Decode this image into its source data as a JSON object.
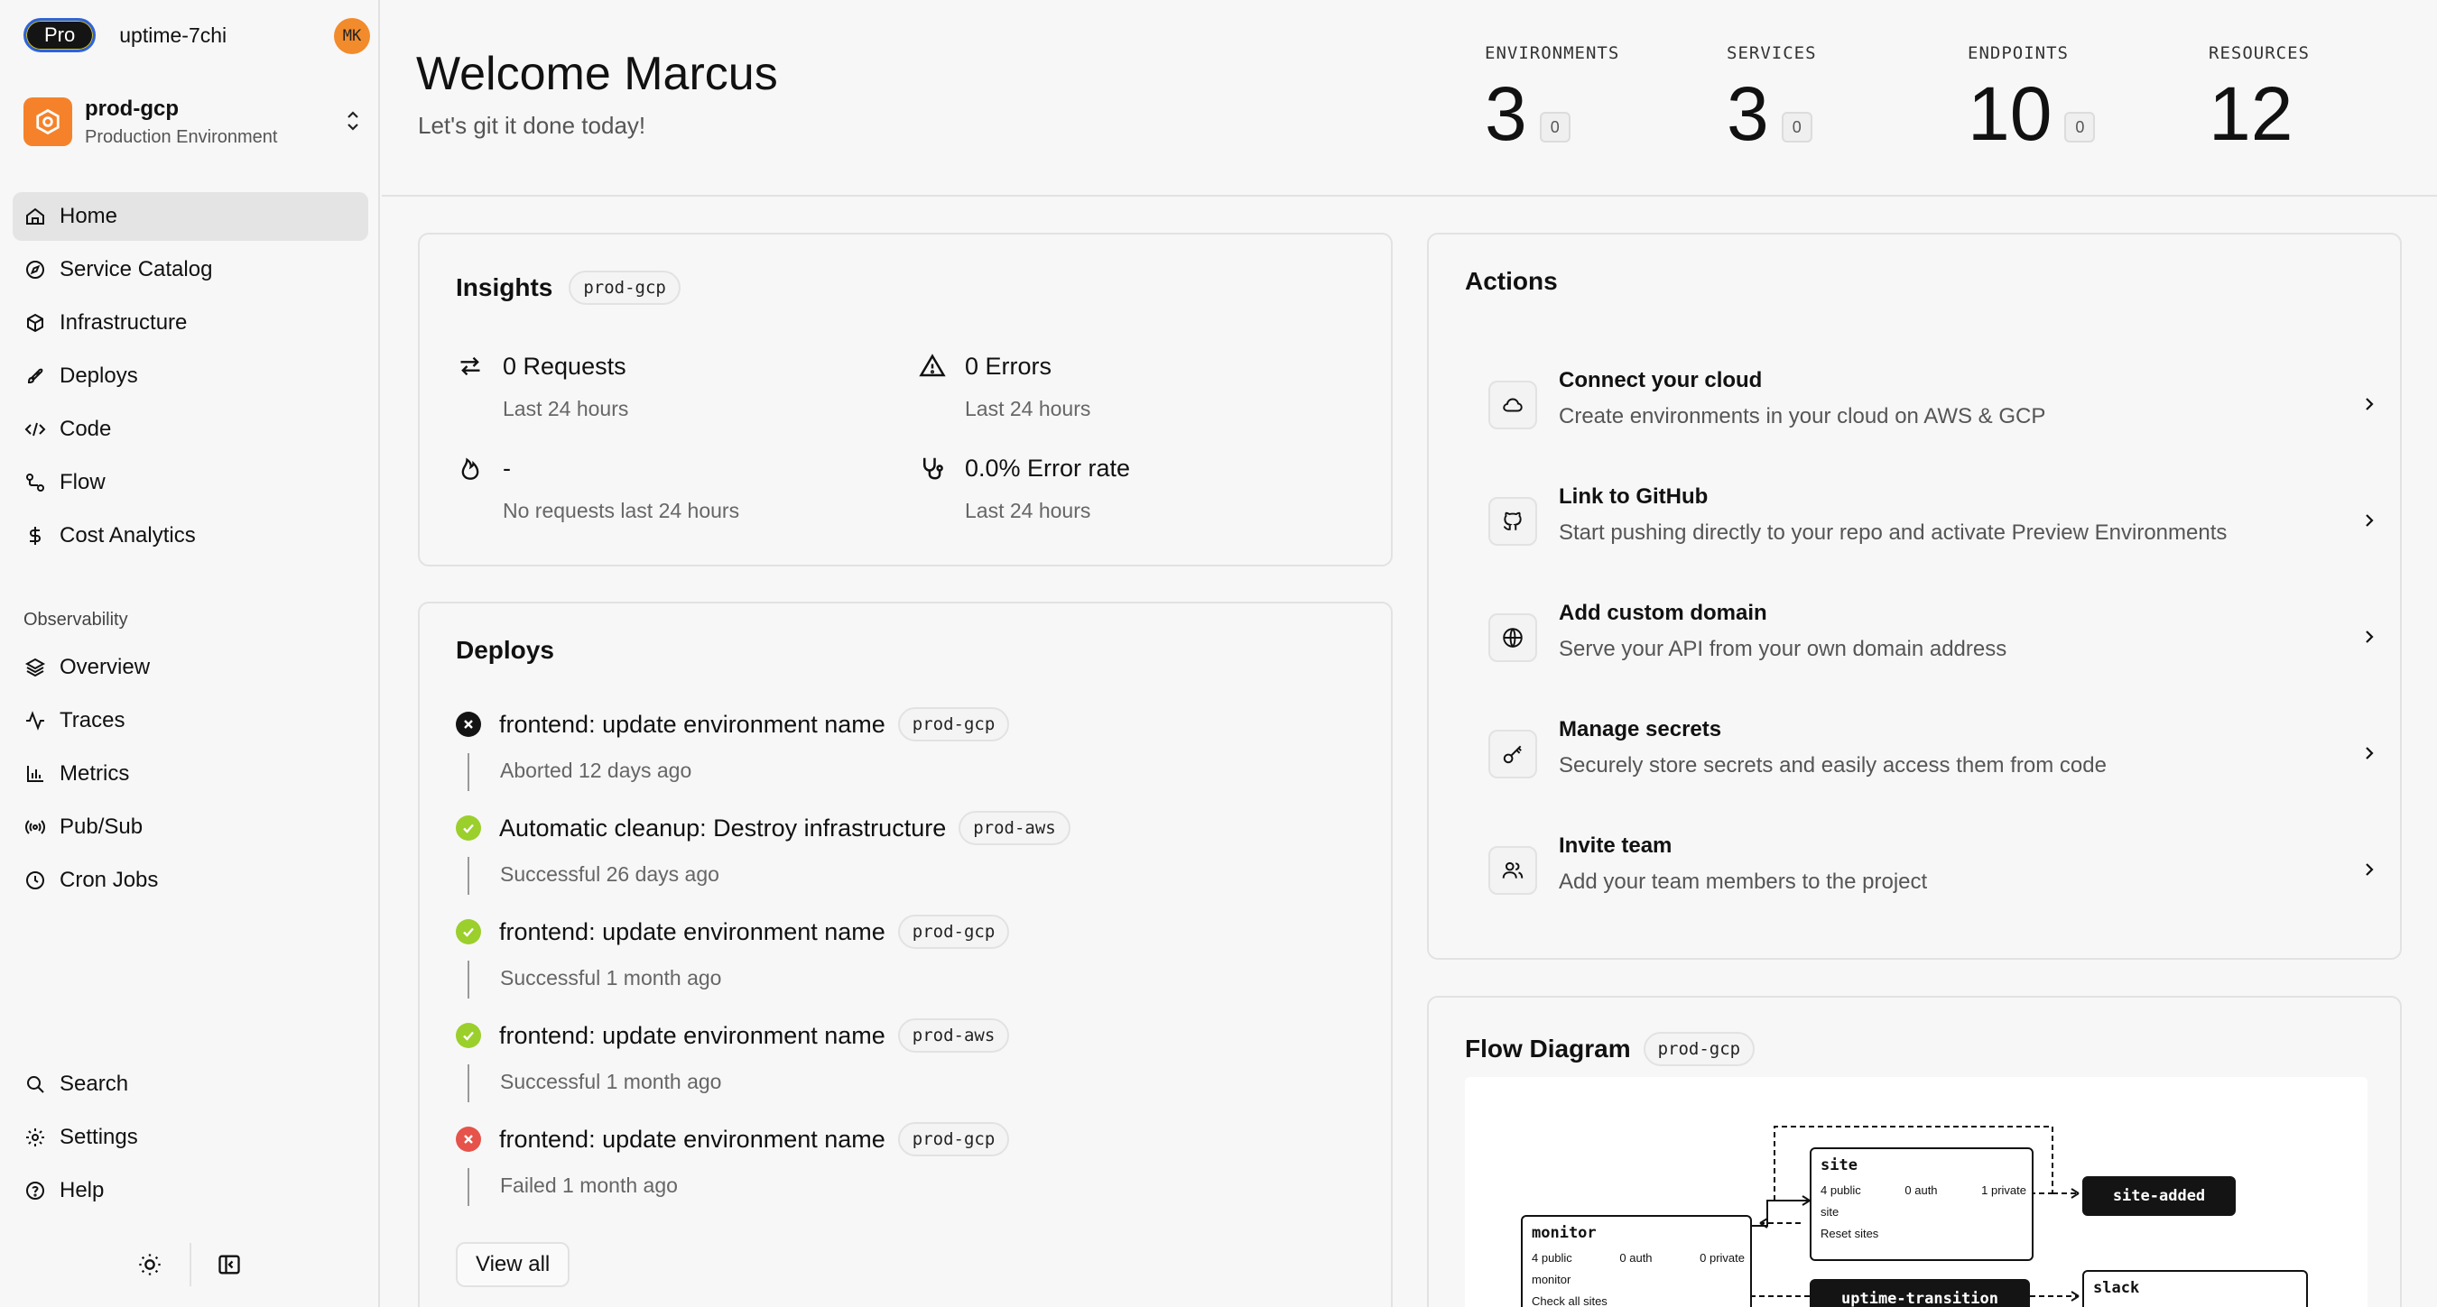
{
  "org": {
    "plan": "Pro",
    "name": "uptime-7chi",
    "avatar_initials": "MK"
  },
  "env": {
    "name": "prod-gcp",
    "description": "Production Environment"
  },
  "nav": {
    "main": [
      {
        "label": "Home",
        "icon": "home-icon"
      },
      {
        "label": "Service Catalog",
        "icon": "compass-icon"
      },
      {
        "label": "Infrastructure",
        "icon": "box-icon"
      },
      {
        "label": "Deploys",
        "icon": "rocket-icon"
      },
      {
        "label": "Code",
        "icon": "code-icon"
      },
      {
        "label": "Flow",
        "icon": "flow-icon"
      },
      {
        "label": "Cost Analytics",
        "icon": "dollar-icon"
      }
    ],
    "observability_label": "Observability",
    "observability": [
      {
        "label": "Overview",
        "icon": "layers-icon"
      },
      {
        "label": "Traces",
        "icon": "activity-icon"
      },
      {
        "label": "Metrics",
        "icon": "bar-chart-icon"
      },
      {
        "label": "Pub/Sub",
        "icon": "broadcast-icon"
      },
      {
        "label": "Cron Jobs",
        "icon": "clock-icon"
      }
    ],
    "bottom": [
      {
        "label": "Search",
        "icon": "search-icon"
      },
      {
        "label": "Settings",
        "icon": "gear-icon"
      },
      {
        "label": "Help",
        "icon": "help-icon"
      }
    ]
  },
  "header": {
    "welcome": "Welcome Marcus",
    "subtitle": "Let's git it done today!",
    "stats": [
      {
        "label": "ENVIRONMENTS",
        "value": "3",
        "delta": "0"
      },
      {
        "label": "SERVICES",
        "value": "3",
        "delta": "0"
      },
      {
        "label": "ENDPOINTS",
        "value": "10",
        "delta": "0"
      },
      {
        "label": "RESOURCES",
        "value": "12"
      }
    ]
  },
  "insights": {
    "title": "Insights",
    "env_tag": "prod-gcp",
    "items": [
      {
        "value": "0 Requests",
        "caption": "Last 24 hours"
      },
      {
        "value": "0 Errors",
        "caption": "Last 24 hours"
      },
      {
        "value": "-",
        "caption": "No requests last 24 hours"
      },
      {
        "value": "0.0% Error rate",
        "caption": "Last 24 hours"
      }
    ]
  },
  "deploys": {
    "title": "Deploys",
    "items": [
      {
        "message": "frontend: update environment name",
        "env": "prod-gcp",
        "status": "Aborted 12 days ago",
        "state": "aborted"
      },
      {
        "message": "Automatic cleanup: Destroy infrastructure",
        "env": "prod-aws",
        "status": "Successful 26 days ago",
        "state": "success"
      },
      {
        "message": "frontend: update environment name",
        "env": "prod-gcp",
        "status": "Successful 1 month ago",
        "state": "success"
      },
      {
        "message": "frontend: update environment name",
        "env": "prod-aws",
        "status": "Successful 1 month ago",
        "state": "success"
      },
      {
        "message": "frontend: update environment name",
        "env": "prod-gcp",
        "status": "Failed 1 month ago",
        "state": "failed"
      }
    ],
    "view_all": "View all"
  },
  "actions": {
    "title": "Actions",
    "items": [
      {
        "title": "Connect your cloud",
        "description": "Create environments in your cloud on AWS & GCP",
        "icon": "cloud-icon"
      },
      {
        "title": "Link to GitHub",
        "description": "Start pushing directly to your repo and activate Preview Environments",
        "icon": "github-icon"
      },
      {
        "title": "Add custom domain",
        "description": "Serve your API from your own domain address",
        "icon": "globe-icon"
      },
      {
        "title": "Manage secrets",
        "description": "Securely store secrets and easily access them from code",
        "icon": "key-icon"
      },
      {
        "title": "Invite team",
        "description": "Add your team members to the project",
        "icon": "users-icon"
      }
    ]
  },
  "flow": {
    "title": "Flow Diagram",
    "env_tag": "prod-gcp",
    "nodes": {
      "site": {
        "name": "site",
        "public": "4 public",
        "auth": "0 auth",
        "private": "1 private",
        "db": "site",
        "cron": "Reset sites"
      },
      "monitor": {
        "name": "monitor",
        "public": "4 public",
        "auth": "0 auth",
        "private": "0 private",
        "db": "monitor",
        "cron": "Check all sites"
      },
      "site_added": {
        "name": "site-added"
      },
      "uptime_transition": {
        "name": "uptime-transition"
      },
      "slack": {
        "name": "slack"
      }
    }
  },
  "colors": {
    "accent_orange": "#f5822a",
    "success": "#9bcf2b",
    "failed": "#e5534b",
    "aborted": "#141414"
  }
}
